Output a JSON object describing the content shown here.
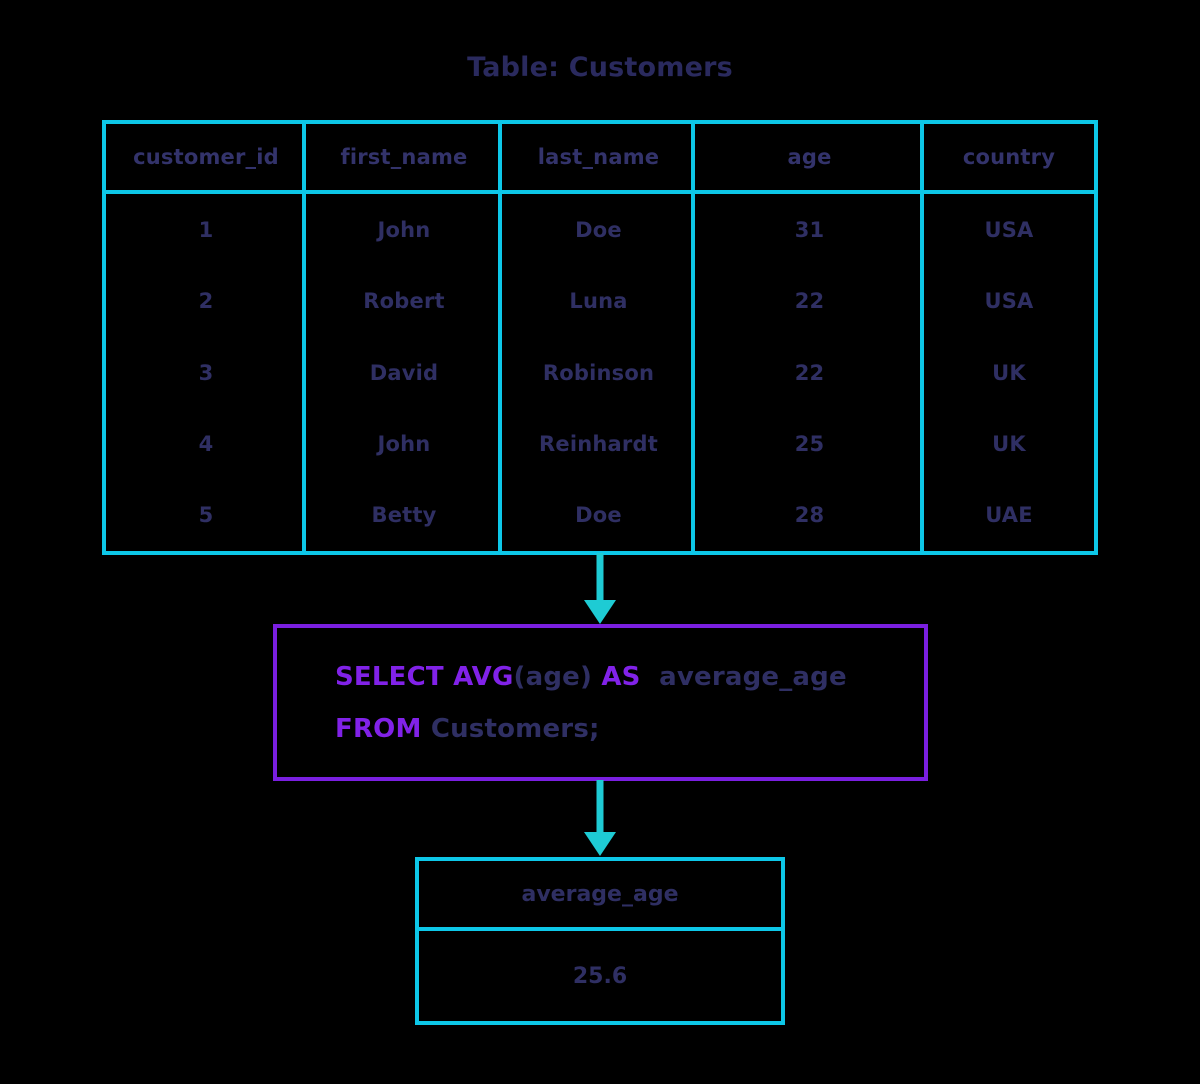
{
  "diagram": {
    "title": "Table: Customers",
    "colors": {
      "table_border": "#0dc7e8",
      "arrow": "#1ecbd4",
      "sql_border": "#7a1fe0",
      "keyword": "#8122e8",
      "text": "#2f2f63",
      "background": "#000000"
    }
  },
  "source_table": {
    "name": "Customers",
    "columns": [
      "customer_id",
      "first_name",
      "last_name",
      "age",
      "country"
    ],
    "rows": [
      [
        "1",
        "John",
        "Doe",
        "31",
        "USA"
      ],
      [
        "2",
        "Robert",
        "Luna",
        "22",
        "USA"
      ],
      [
        "3",
        "David",
        "Robinson",
        "22",
        "UK"
      ],
      [
        "4",
        "John",
        "Reinhardt",
        "25",
        "UK"
      ],
      [
        "5",
        "Betty",
        "Doe",
        "28",
        "UAE"
      ]
    ]
  },
  "query": {
    "line1": {
      "kw1": "SELECT ",
      "kw2": "AVG",
      "arg": "(age)",
      "kw3": " AS ",
      "alias": " average_age"
    },
    "line2": {
      "kw1": "FROM ",
      "table": "Customers;"
    },
    "full_text": "SELECT AVG(age) AS average_age FROM Customers;"
  },
  "result_table": {
    "columns": [
      "average_age"
    ],
    "rows": [
      [
        "25.6"
      ]
    ]
  },
  "arrows": [
    {
      "name": "table-to-query",
      "direction": "down"
    },
    {
      "name": "query-to-result",
      "direction": "down"
    }
  ]
}
